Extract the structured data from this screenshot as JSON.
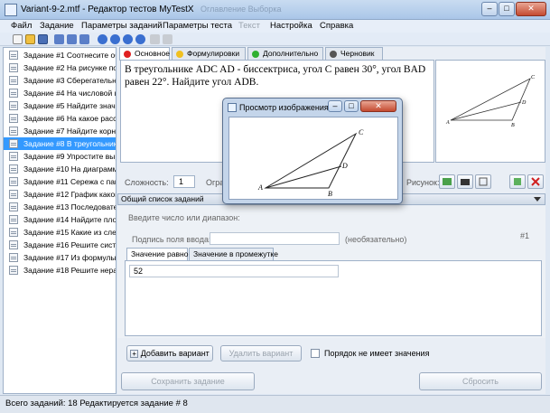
{
  "window": {
    "title": "Variant-9-2.mtf - Редактор тестов MyTestX",
    "faded_tabs": "Оглавление    Выборка"
  },
  "menu": [
    "Файл",
    "Задание",
    "Параметры заданий",
    "Параметры теста",
    "Текст",
    "Настройка",
    "Справка"
  ],
  "tasks": [
    "Задание #1 Соотнесите об",
    "Задание #2 На рисунке пок",
    "Задание #3 Сберегательн",
    "Задание #4 На числовой п",
    "Задание #5 Найдите значе",
    "Задание #6 На какое расст",
    "Задание #7 Найдите корни",
    "Задание #8 В треугольник",
    "Задание #9 Упростите выр",
    "Задание #10 На диаграмме",
    "Задание #11 Сережа с пап",
    "Задание #12 График какой",
    "Задание #13 Последовате",
    "Задание #14 Найдите плоц",
    "Задание #15 Какие из след",
    "Задание #16 Решите систе",
    "Задание #17 Из формулы",
    "Задание #18 Решите нерав"
  ],
  "selected_task_index": 7,
  "tabs": [
    {
      "label": "Основное",
      "color": "#e02020"
    },
    {
      "label": "Формулировки",
      "color": "#f0c020"
    },
    {
      "label": "Дополнительно",
      "color": "#30b030"
    },
    {
      "label": "Черновик",
      "color": "#555555"
    }
  ],
  "question_text": "В треугольнике ADC   AD - биссектриса, угол C равен 30°, угол BAD равен 22°. Найдите угол ADB.",
  "complexity": {
    "label": "Сложность:",
    "value": "1",
    "limit_label": "Огра",
    "picture_label": "Рисунок:"
  },
  "group_header": "Общий список заданий",
  "answer": {
    "hint": "Введите число или диапазон:",
    "caption_label": "Подпись поля ввода:",
    "caption_value": "",
    "optional": "(необязательно)",
    "number": "#1",
    "subtabs": [
      "Значение равно",
      "Значение в промежутке"
    ],
    "value": "52"
  },
  "buttons": {
    "add_variant": "Добавить вариант",
    "delete_variant": "Удалить вариант",
    "order_checkbox": "Порядок не имеет значения",
    "save_task": "Сохранить задание",
    "reset": "Сбросить"
  },
  "status": "Всего заданий: 18  Редактируется задание # 8",
  "dialog": {
    "title": "Просмотр изображения ..."
  },
  "figure_labels": {
    "A": "A",
    "B": "B",
    "C": "C",
    "D": "D"
  }
}
